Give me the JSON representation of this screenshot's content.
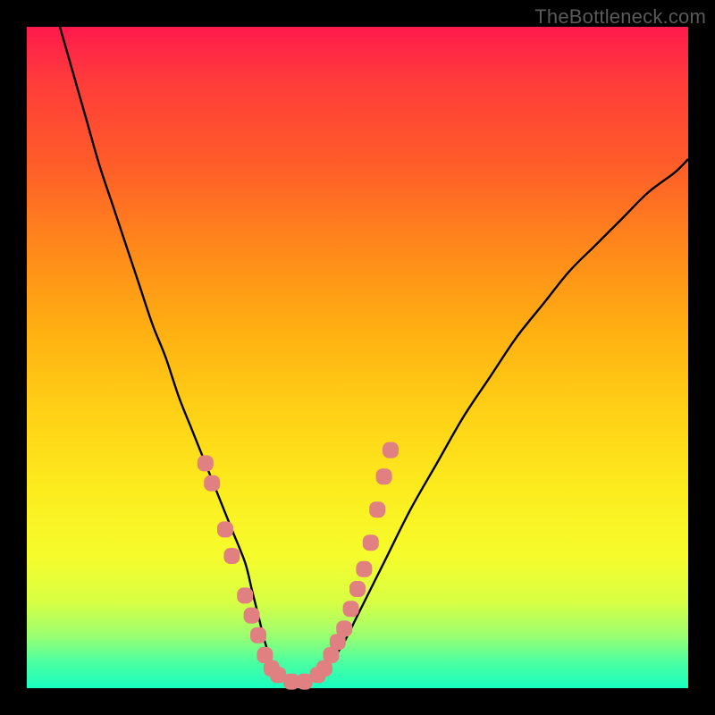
{
  "watermark": "TheBottleneck.com",
  "colors": {
    "frame": "#000000",
    "curve": "#000000",
    "marker": "#e08080",
    "gradient_top": "#ff1a4d",
    "gradient_bottom": "#18ffc2"
  },
  "chart_data": {
    "type": "line",
    "title": "",
    "xlabel": "",
    "ylabel": "",
    "xlim": [
      0,
      100
    ],
    "ylim": [
      0,
      100
    ],
    "series": [
      {
        "name": "bottleneck-curve",
        "x": [
          5,
          7,
          9,
          11,
          13,
          15,
          17,
          19,
          21,
          23,
          25,
          27,
          29,
          31,
          33,
          34,
          35,
          36,
          37,
          38,
          40,
          42,
          44,
          46,
          48,
          50,
          54,
          58,
          62,
          66,
          70,
          74,
          78,
          82,
          86,
          90,
          94,
          98,
          100
        ],
        "y": [
          100,
          93,
          86,
          79,
          73,
          67,
          61,
          55,
          50,
          44,
          39,
          34,
          29,
          24,
          19,
          15,
          11,
          7,
          4,
          2,
          1,
          1,
          2,
          4,
          7,
          11,
          19,
          27,
          34,
          41,
          47,
          53,
          58,
          63,
          67,
          71,
          75,
          78,
          80
        ]
      }
    ],
    "markers": {
      "name": "highlighted-points",
      "color": "#e08080",
      "points": [
        {
          "x": 27,
          "y": 34
        },
        {
          "x": 28,
          "y": 31
        },
        {
          "x": 30,
          "y": 24
        },
        {
          "x": 31,
          "y": 20
        },
        {
          "x": 33,
          "y": 14
        },
        {
          "x": 34,
          "y": 11
        },
        {
          "x": 35,
          "y": 8
        },
        {
          "x": 36,
          "y": 5
        },
        {
          "x": 37,
          "y": 3
        },
        {
          "x": 38,
          "y": 2
        },
        {
          "x": 40,
          "y": 1
        },
        {
          "x": 42,
          "y": 1
        },
        {
          "x": 44,
          "y": 2
        },
        {
          "x": 45,
          "y": 3
        },
        {
          "x": 46,
          "y": 5
        },
        {
          "x": 47,
          "y": 7
        },
        {
          "x": 48,
          "y": 9
        },
        {
          "x": 49,
          "y": 12
        },
        {
          "x": 50,
          "y": 15
        },
        {
          "x": 51,
          "y": 18
        },
        {
          "x": 52,
          "y": 22
        },
        {
          "x": 53,
          "y": 27
        },
        {
          "x": 54,
          "y": 32
        },
        {
          "x": 55,
          "y": 36
        }
      ]
    }
  }
}
